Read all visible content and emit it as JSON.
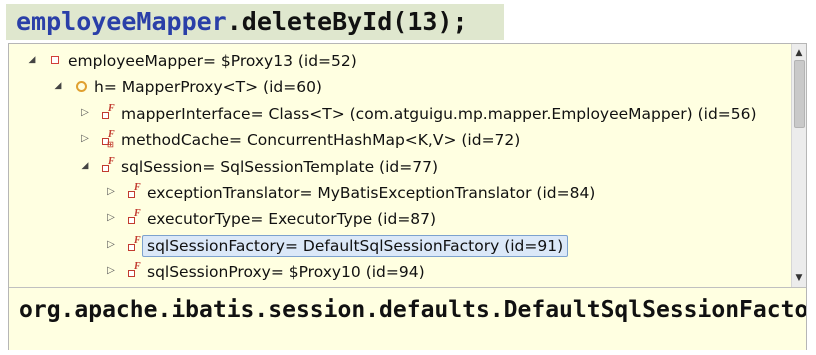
{
  "code": {
    "object": "employeeMapper",
    "call": ".deleteById(13);"
  },
  "tree": [
    {
      "level": 0,
      "expanded": true,
      "icon": "local-variable-icon",
      "text": "employeeMapper= $Proxy13  (id=52)"
    },
    {
      "level": 1,
      "expanded": true,
      "icon": "protected-field-icon",
      "text": "h= MapperProxy<T>  (id=60)"
    },
    {
      "level": 2,
      "expanded": false,
      "icon": "final-field-icon",
      "text": "mapperInterface= Class<T> (com.atguigu.mp.mapper.EmployeeMapper) (id=56)"
    },
    {
      "level": 2,
      "expanded": false,
      "icon": "final-collection-field-icon",
      "text": "methodCache= ConcurrentHashMap<K,V>  (id=72)"
    },
    {
      "level": 2,
      "expanded": true,
      "icon": "final-field-icon",
      "text": "sqlSession= SqlSessionTemplate  (id=77)"
    },
    {
      "level": 3,
      "expanded": false,
      "icon": "final-field-icon",
      "text": "exceptionTranslator= MyBatisExceptionTranslator  (id=84)"
    },
    {
      "level": 3,
      "expanded": false,
      "icon": "final-field-icon",
      "text": "executorType= ExecutorType  (id=87)"
    },
    {
      "level": 3,
      "expanded": false,
      "icon": "final-field-icon",
      "text": "sqlSessionFactory= DefaultSqlSessionFactory  (id=91)",
      "selected": true
    },
    {
      "level": 3,
      "expanded": false,
      "icon": "final-field-icon",
      "text": "sqlSessionProxy= $Proxy10  (id=94)"
    }
  ],
  "detail": "org.apache.ibatis.session.defaults.DefaultSqlSessionFactory@"
}
